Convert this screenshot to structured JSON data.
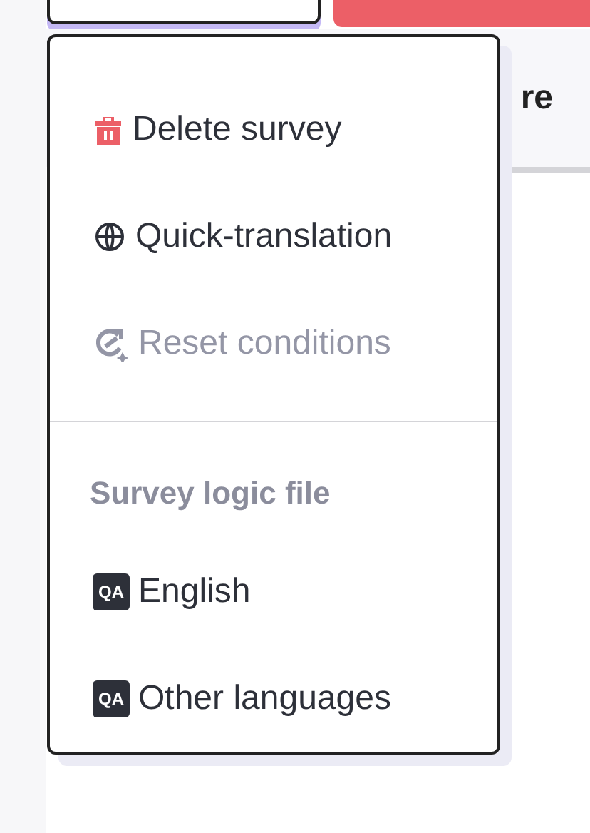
{
  "background": {
    "tab_label": "re"
  },
  "menu": {
    "items": [
      {
        "kind": "delete",
        "label": "Delete survey",
        "disabled": false
      },
      {
        "kind": "translate",
        "label": "Quick-translation",
        "disabled": false
      },
      {
        "kind": "reset",
        "label": "Reset conditions",
        "disabled": true
      },
      {
        "kind": "divider"
      },
      {
        "kind": "header",
        "label": "Survey logic file"
      },
      {
        "kind": "file",
        "icon_text": "QA",
        "label": "English",
        "disabled": false
      },
      {
        "kind": "file",
        "icon_text": "QA",
        "label": "Other languages",
        "disabled": false
      }
    ]
  }
}
